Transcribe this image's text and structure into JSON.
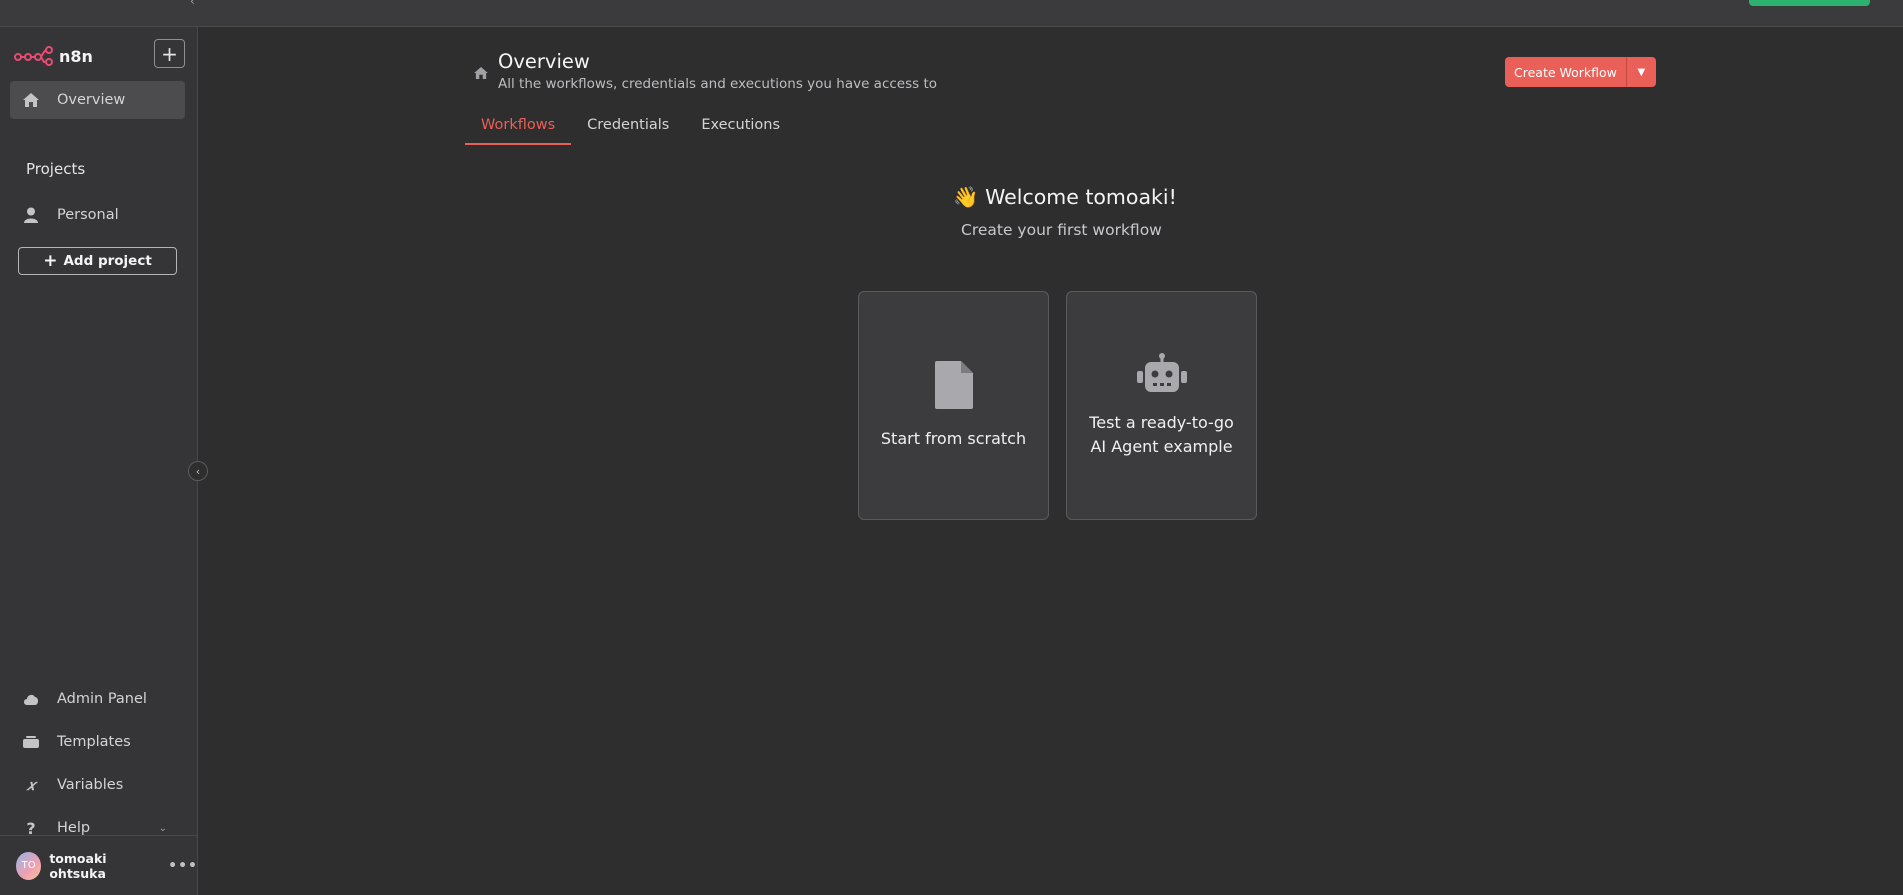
{
  "app": {
    "name": "n8n"
  },
  "colors": {
    "accent": "#ea5f57",
    "sidebar_bg": "#353537",
    "main_bg": "#2e2e2e",
    "green": "#2cb16f"
  },
  "sidebar": {
    "overview_label": "Overview",
    "projects_label": "Projects",
    "personal_label": "Personal",
    "add_project_label": "Add project",
    "bottom_items": [
      {
        "label": "Admin Panel",
        "icon": "cloud-icon"
      },
      {
        "label": "Templates",
        "icon": "templates-icon"
      },
      {
        "label": "Variables",
        "icon": "variables-icon"
      },
      {
        "label": "Help",
        "icon": "help-icon"
      }
    ],
    "user": {
      "initials": "TO",
      "name": "tomoaki ohtsuka"
    }
  },
  "header": {
    "title": "Overview",
    "subtitle": "All the workflows, credentials and executions you have access to",
    "create_button_label": "Create Workflow"
  },
  "tabs": [
    {
      "label": "Workflows",
      "active": true
    },
    {
      "label": "Credentials",
      "active": false
    },
    {
      "label": "Executions",
      "active": false
    }
  ],
  "welcome": {
    "emoji": "👋",
    "title": "Welcome tomoaki!",
    "subtitle": "Create your first workflow"
  },
  "cards": [
    {
      "lines": [
        "Start from scratch"
      ],
      "icon": "file-icon"
    },
    {
      "lines": [
        "Test a ready-to-go",
        "AI Agent example"
      ],
      "icon": "robot-icon"
    }
  ]
}
